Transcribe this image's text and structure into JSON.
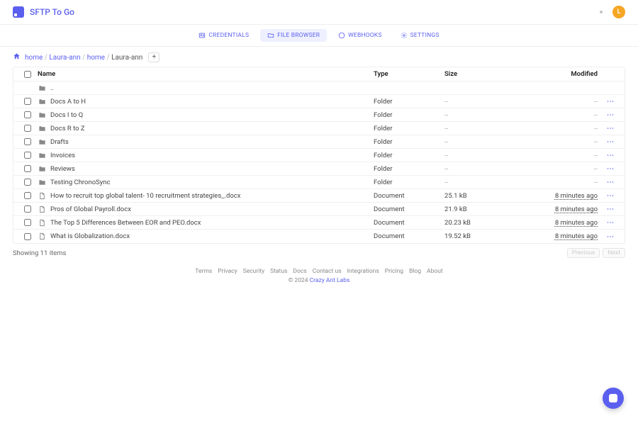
{
  "header": {
    "brand": "SFTP To Go",
    "avatar_initial": "L"
  },
  "tabs": [
    {
      "id": "credentials",
      "label": "CREDENTIALS",
      "icon": "id-card"
    },
    {
      "id": "filebrowser",
      "label": "FILE BROWSER",
      "icon": "folder",
      "active": true
    },
    {
      "id": "webhooks",
      "label": "WEBHOOKS",
      "icon": "bolt"
    },
    {
      "id": "settings",
      "label": "SETTINGS",
      "icon": "gear"
    }
  ],
  "breadcrumbs": [
    {
      "label": "home"
    },
    {
      "label": "Laura-ann"
    },
    {
      "label": "home"
    },
    {
      "label": "Laura-ann",
      "current": true
    }
  ],
  "columns": {
    "name": "Name",
    "type": "Type",
    "size": "Size",
    "modified": "Modified"
  },
  "parent_row": {
    "label": ".."
  },
  "items": [
    {
      "name": "Docs A to H",
      "type": "Folder",
      "size": "--",
      "modified": "--",
      "icon": "folder"
    },
    {
      "name": "Docs I to Q",
      "type": "Folder",
      "size": "--",
      "modified": "--",
      "icon": "folder"
    },
    {
      "name": "Docs R to Z",
      "type": "Folder",
      "size": "--",
      "modified": "--",
      "icon": "folder"
    },
    {
      "name": "Drafts",
      "type": "Folder",
      "size": "--",
      "modified": "--",
      "icon": "folder"
    },
    {
      "name": "Invoices",
      "type": "Folder",
      "size": "--",
      "modified": "--",
      "icon": "folder"
    },
    {
      "name": "Reviews",
      "type": "Folder",
      "size": "--",
      "modified": "--",
      "icon": "folder"
    },
    {
      "name": "Testing ChronoSync",
      "type": "Folder",
      "size": "--",
      "modified": "--",
      "icon": "folder"
    },
    {
      "name": "How to recruit top global talent- 10 recruitment strategies_.docx",
      "type": "Document",
      "size": "25.1 kB",
      "modified": "8 minutes ago",
      "icon": "file"
    },
    {
      "name": "Pros of Global Payroll.docx",
      "type": "Document",
      "size": "21.9 kB",
      "modified": "8 minutes ago",
      "icon": "file"
    },
    {
      "name": "The Top 5 Differences Between EOR and PEO.docx",
      "type": "Document",
      "size": "20.23 kB",
      "modified": "8 minutes ago",
      "icon": "file"
    },
    {
      "name": "What is Globalization.docx",
      "type": "Document",
      "size": "19.52 kB",
      "modified": "8 minutes ago",
      "icon": "file"
    }
  ],
  "pager": {
    "status": "Showing 11 items",
    "prev": "Previous",
    "next": "Next"
  },
  "footer": {
    "links": [
      "Terms",
      "Privacy",
      "Security",
      "Status",
      "Docs",
      "Contact us",
      "Integrations",
      "Pricing",
      "Blog",
      "About"
    ],
    "copyright_prefix": "© 2024 ",
    "copyright_brand": "Crazy Ant Labs"
  }
}
